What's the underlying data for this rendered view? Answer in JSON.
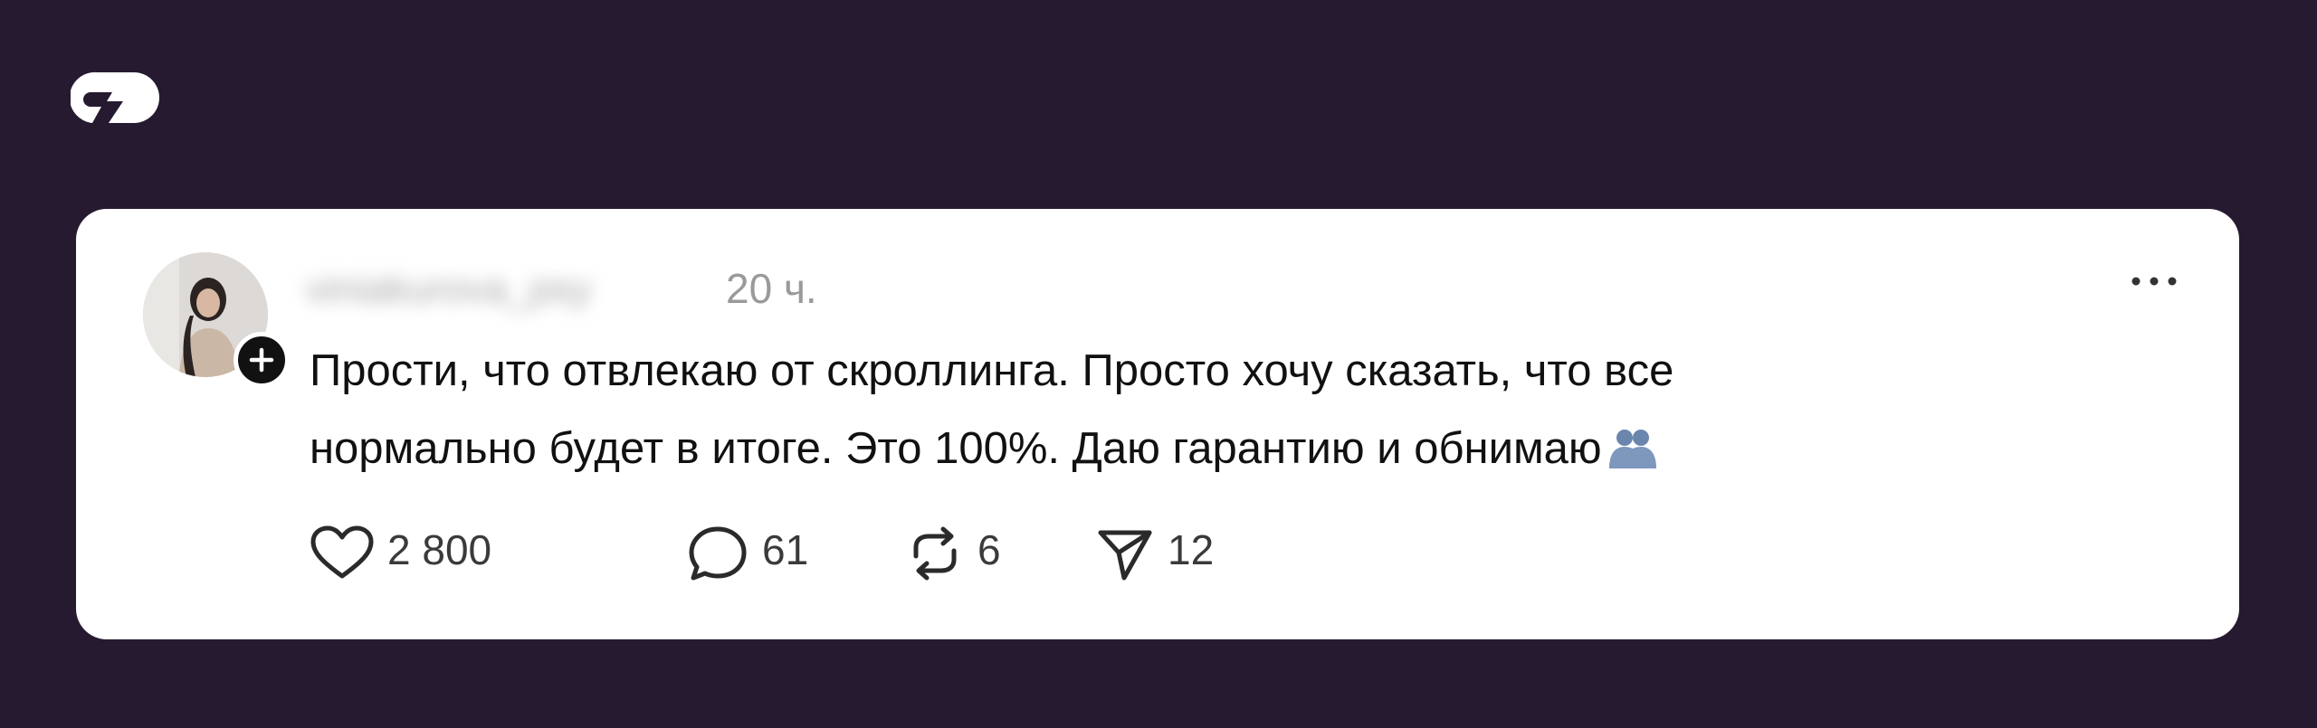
{
  "brand": {
    "logo_icon": "brand-logo-icon",
    "background": "#261a31"
  },
  "post": {
    "username": "viniakurova_psy",
    "time": "20 ч.",
    "text_line1": "Прости, что отвлекаю от скроллинга. Просто хочу сказать, что все",
    "text_line2": "нормально будет в итоге. Это 100%. Даю гарантию и обнимаю",
    "emoji": "hugging-people-emoji",
    "more_icon": "more-options-icon",
    "actions": {
      "likes": "2 800",
      "comments": "61",
      "reposts": "6",
      "shares": "12"
    }
  }
}
